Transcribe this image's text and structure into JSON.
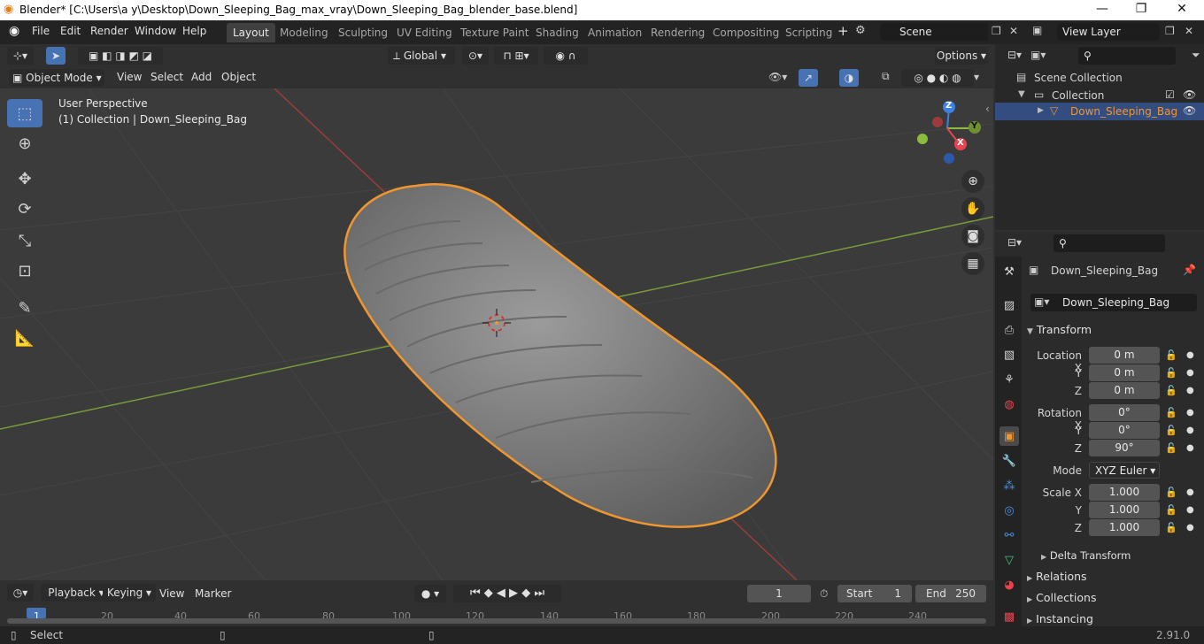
{
  "window": {
    "title": "Blender* [C:\\Users\\a y\\Desktop\\Down_Sleeping_Bag_max_vray\\Down_Sleeping_Bag_blender_base.blend]",
    "minimize": "—",
    "maximize": "❐",
    "close": "✕"
  },
  "menu": [
    "File",
    "Edit",
    "Render",
    "Window",
    "Help"
  ],
  "workspaces": [
    "Layout",
    "Modeling",
    "Sculpting",
    "UV Editing",
    "Texture Paint",
    "Shading",
    "Animation",
    "Rendering",
    "Compositing",
    "Scripting"
  ],
  "workspace_add": "+",
  "scene": {
    "name": "Scene",
    "view_layer": "View Layer"
  },
  "toolheader": {
    "orientation": "Global",
    "options": "Options"
  },
  "viewport_header": {
    "mode": "Object Mode",
    "menus": [
      "View",
      "Select",
      "Add",
      "Object"
    ]
  },
  "viewport": {
    "perspective": "User Perspective",
    "collection_info": "(1) Collection | Down_Sleeping_Bag"
  },
  "gizmo": {
    "x": "X",
    "y": "Y",
    "z": "Z"
  },
  "outliner": {
    "root": "Scene Collection",
    "collection": "Collection",
    "object": "Down_Sleeping_Bag"
  },
  "properties": {
    "object_name": "Down_Sleeping_Bag",
    "data_name": "Down_Sleeping_Bag",
    "transform_title": "Transform",
    "location": {
      "label_x": "Location X",
      "label_y": "Y",
      "label_z": "Z",
      "x": "0 m",
      "y": "0 m",
      "z": "0 m"
    },
    "rotation": {
      "label_x": "Rotation X",
      "label_y": "Y",
      "label_z": "Z",
      "x": "0°",
      "y": "0°",
      "z": "90°"
    },
    "mode_label": "Mode",
    "mode_value": "XYZ Euler",
    "scale": {
      "label_x": "Scale X",
      "label_y": "Y",
      "label_z": "Z",
      "x": "1.000",
      "y": "1.000",
      "z": "1.000"
    },
    "delta_transform": "Delta Transform",
    "sections": [
      "Relations",
      "Collections",
      "Instancing"
    ]
  },
  "timeline": {
    "menus": [
      "Playback",
      "Keying",
      "View",
      "Marker"
    ],
    "current_frame": "1",
    "start_label": "Start",
    "start": "1",
    "end_label": "End",
    "end": "250",
    "ticks": [
      "1",
      "20",
      "40",
      "60",
      "80",
      "100",
      "120",
      "140",
      "160",
      "180",
      "200",
      "220",
      "240"
    ]
  },
  "status": {
    "left": "Select",
    "version": "2.91.0"
  },
  "colors": {
    "selection": "#f0962f",
    "accent": "#4772b3",
    "x_axis": "#e8434e",
    "y_axis": "#8cbc3e",
    "z_axis": "#3c80e0"
  }
}
